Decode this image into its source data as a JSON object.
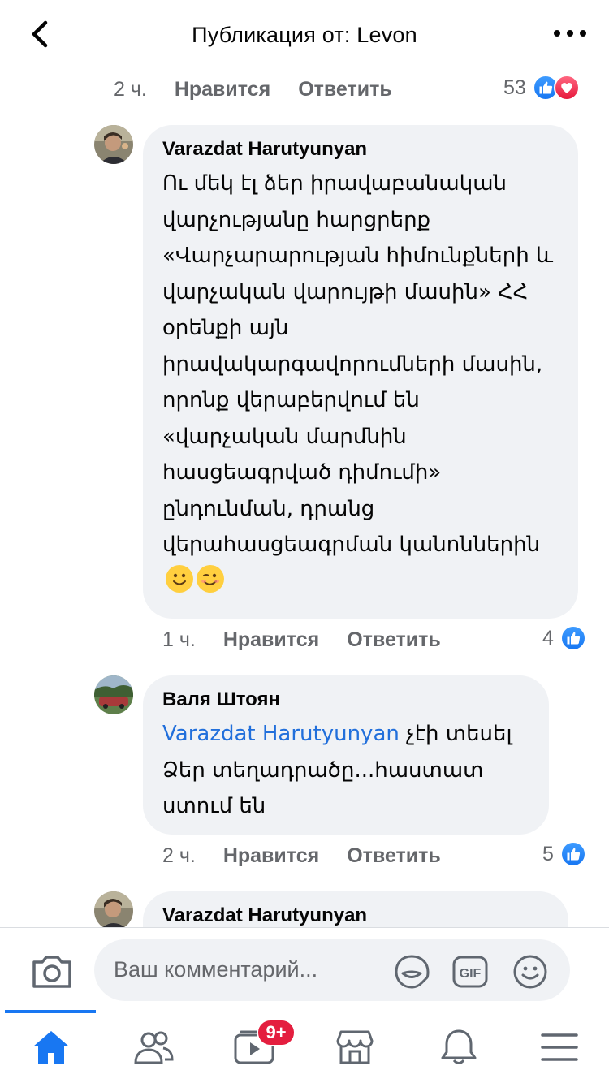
{
  "header": {
    "title": "Публикация от: Levon"
  },
  "top_meta": {
    "time": "2 ч.",
    "like": "Нравится",
    "reply": "Ответить",
    "reactions_count": "53"
  },
  "comments": [
    {
      "author": "Varazdat Harutyunyan",
      "text": "Ու մեկ էլ ձեր իրավաբանական վարչությանը հարցրերք «Վարչարարության հիմունքների և վարչական վարույթի մասին» ՀՀ օրենքի այն իրավակարգավորումների մասին, որոնք վերաբերվում են «վարչական մարմնին հասցեագրված դիմումի» ընդունման, դրանց վերահասցեագրման կանոններին",
      "time": "1 ч.",
      "like": "Нравится",
      "reply": "Ответить",
      "reactions_count": "4"
    },
    {
      "author": "Валя Штоян",
      "mention": "Varazdat Harutyunyan",
      "text": " չէի տեսել Ձեր տեղադրածը...հաստատ ստում են",
      "time": "2 ч.",
      "like": "Нравится",
      "reply": "Ответить",
      "reactions_count": "5"
    },
    {
      "author": "Varazdat Harutyunyan"
    }
  ],
  "composer": {
    "placeholder": "Ваш комментарий...",
    "gif_label": "GIF"
  },
  "tabbar": {
    "watch_badge": "9+"
  },
  "colors": {
    "accent": "#1877f2",
    "mention": "#216fdb",
    "bubble": "#f0f2f5",
    "meta": "#65676b",
    "badge": "#e41e3f"
  }
}
